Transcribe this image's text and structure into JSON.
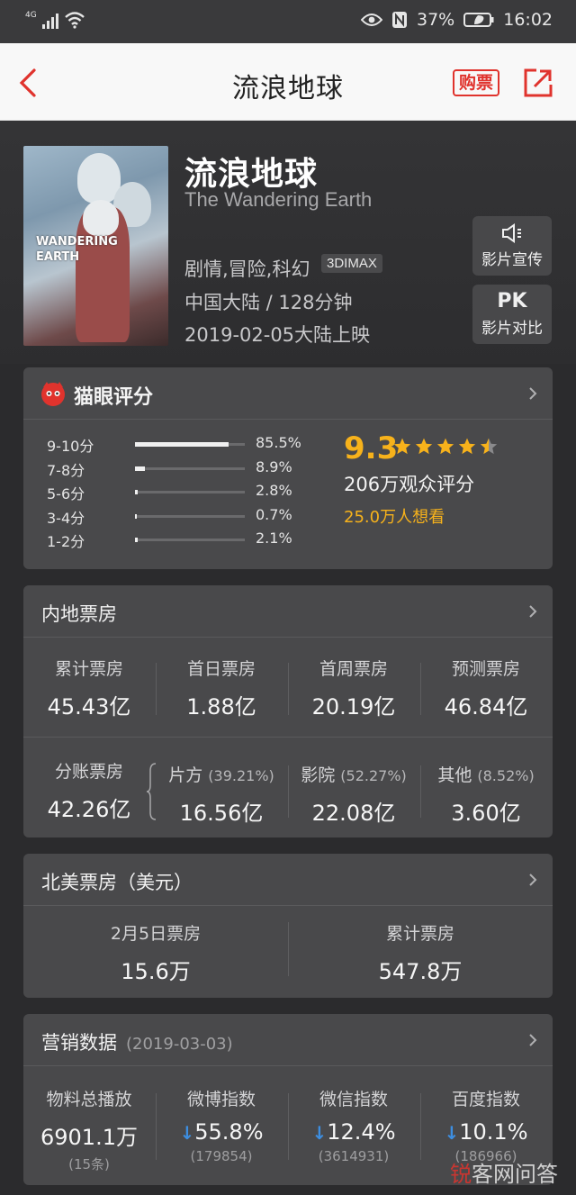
{
  "status_bar": {
    "network": "4G",
    "battery": "37%",
    "time": "16:02"
  },
  "nav": {
    "title": "流浪地球",
    "ticket_label": "购票"
  },
  "movie": {
    "title": "流浪地球",
    "english_title": "The Wandering Earth",
    "genres": "剧情,冒险,科幻",
    "format_badge": "3DIMAX",
    "region_duration": "中国大陆 / 128分钟",
    "release": "2019-02-05大陆上映",
    "poster_text": {
      "line1": "WANDERING",
      "line2": "EARTH"
    },
    "actions": [
      {
        "icon": "megaphone-icon",
        "label": "影片宣传"
      },
      {
        "icon": "pk-icon",
        "icon_text": "PK",
        "label": "影片对比"
      }
    ]
  },
  "rating": {
    "title": "猫眼评分",
    "score": "9.3",
    "stars": 4.5,
    "count_text": "206万观众评分",
    "want_text": "25.0万人想看",
    "distribution": [
      {
        "label": "9-10分",
        "pct": "85.5%",
        "fraction": 0.855
      },
      {
        "label": "7-8分",
        "pct": "8.9%",
        "fraction": 0.089
      },
      {
        "label": "5-6分",
        "pct": "2.8%",
        "fraction": 0.028
      },
      {
        "label": "3-4分",
        "pct": "0.7%",
        "fraction": 0.007
      },
      {
        "label": "1-2分",
        "pct": "2.1%",
        "fraction": 0.021
      }
    ]
  },
  "mainland_box_office": {
    "title": "内地票房",
    "row1": [
      {
        "label": "累计票房",
        "value": "45.43亿"
      },
      {
        "label": "首日票房",
        "value": "1.88亿"
      },
      {
        "label": "首周票房",
        "value": "20.19亿"
      },
      {
        "label": "预测票房",
        "value": "46.84亿"
      }
    ],
    "split_total": {
      "label": "分账票房",
      "value": "42.26亿"
    },
    "row2": [
      {
        "label": "片方",
        "share": "(39.21%)",
        "value": "16.56亿"
      },
      {
        "label": "影院",
        "share": "(52.27%)",
        "value": "22.08亿"
      },
      {
        "label": "其他",
        "share": "(8.52%)",
        "value": "3.60亿"
      }
    ]
  },
  "north_america_box_office": {
    "title": "北美票房（美元）",
    "items": [
      {
        "label": "2月5日票房",
        "value": "15.6万"
      },
      {
        "label": "累计票房",
        "value": "547.8万"
      }
    ]
  },
  "marketing": {
    "title": "营销数据",
    "date": "(2019-03-03)",
    "items": [
      {
        "label": "物料总播放",
        "value": "6901.1万",
        "sub": "(15条)",
        "trend": ""
      },
      {
        "label": "微博指数",
        "value": "55.8%",
        "sub": "(179854)",
        "trend": "↓"
      },
      {
        "label": "微信指数",
        "value": "12.4%",
        "sub": "(3614931)",
        "trend": "↓"
      },
      {
        "label": "百度指数",
        "value": "10.1%",
        "sub": "(186966)",
        "trend": "↓"
      }
    ]
  },
  "watermark": {
    "brand_red": "锐",
    "brand_rest": "客网",
    "suffix": "问答"
  },
  "colors": {
    "accent_red": "#e0332d",
    "rating_gold": "#f7b21b",
    "trend_blue": "#3d8ee0",
    "card_bg": "#49494b",
    "page_bg": "#2b2b2d"
  }
}
